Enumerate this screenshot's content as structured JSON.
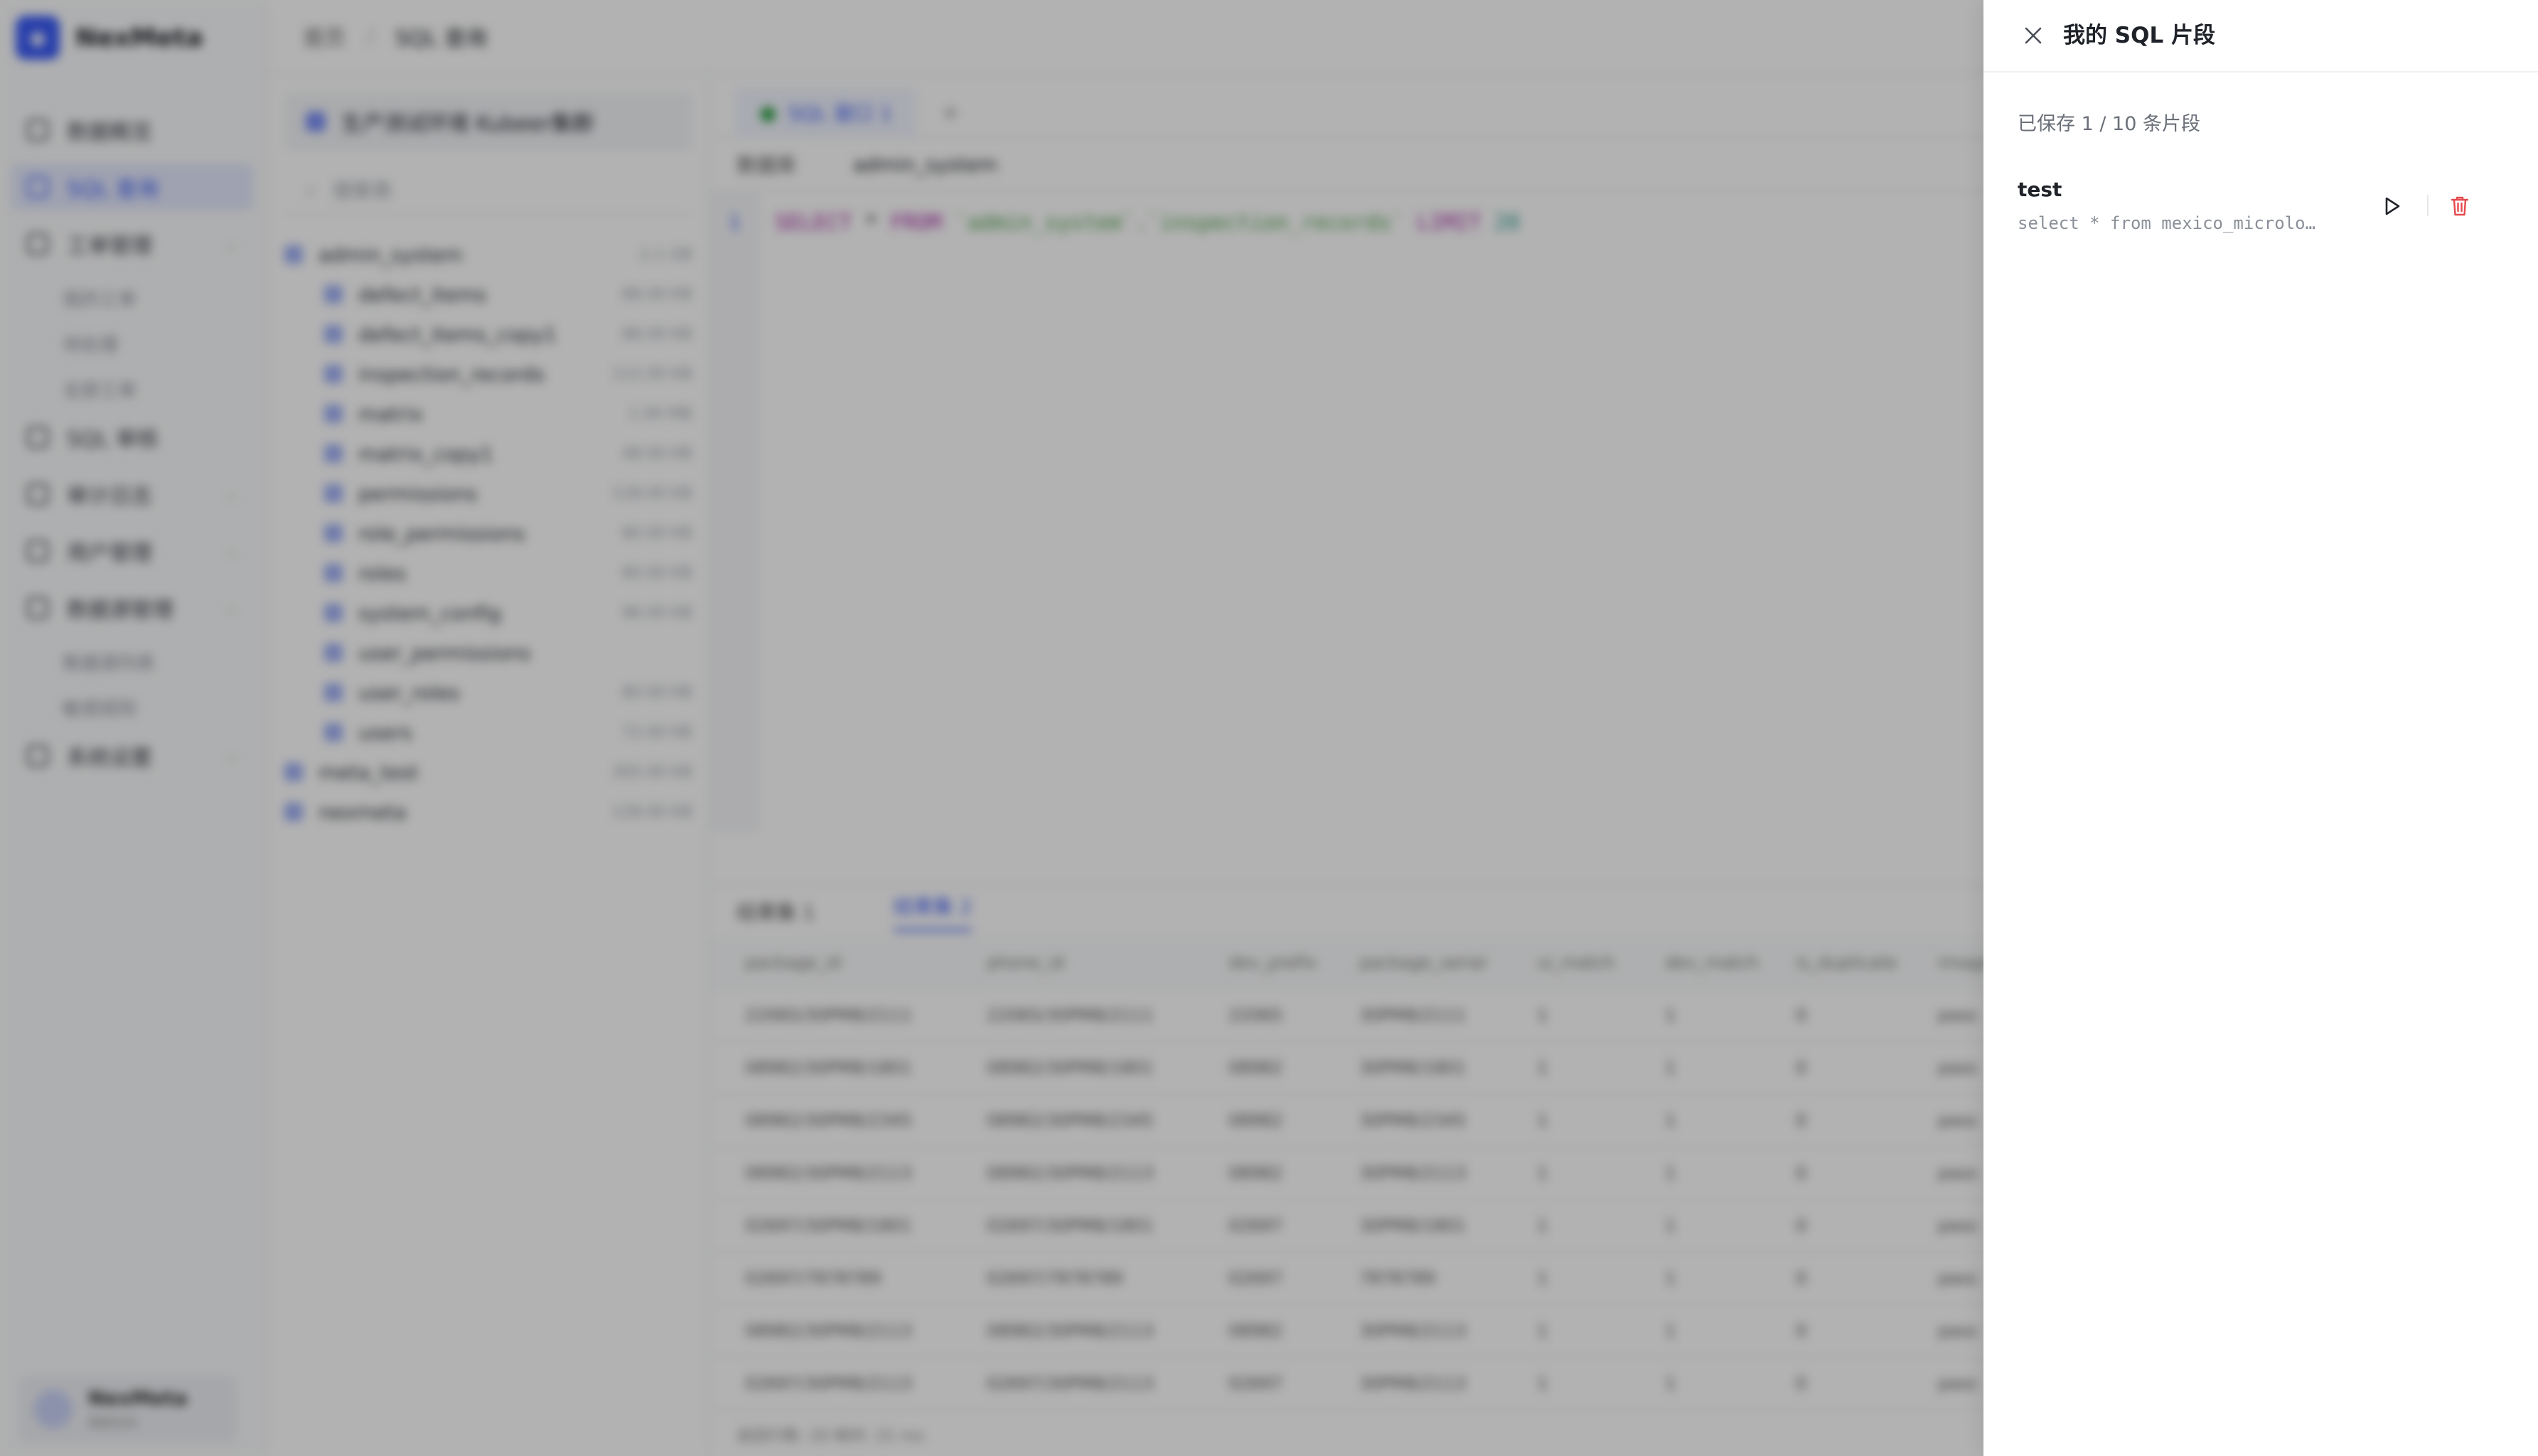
{
  "app": {
    "brand": "NexMeta",
    "nav": [
      {
        "label": "数据概览",
        "active": false,
        "caret": false
      },
      {
        "label": "SQL 查询",
        "active": true,
        "caret": false
      },
      {
        "label": "工单管理",
        "active": false,
        "caret": true
      }
    ],
    "nav_sub": [
      "我的工单",
      "待处理",
      "全部工单"
    ],
    "nav2": [
      {
        "label": "SQL 审核",
        "caret": false
      },
      {
        "label": "审计日志",
        "caret": true
      },
      {
        "label": "用户管理",
        "caret": true
      },
      {
        "label": "数据源管理",
        "caret": true
      }
    ],
    "nav_sub2": [
      "数据源列表",
      "敏感规则"
    ],
    "nav3": [
      {
        "label": "系统设置",
        "caret": true
      }
    ],
    "user": {
      "name": "NexMeta",
      "role": "Admin"
    },
    "breadcrumb": [
      "首页",
      "SQL 查询"
    ],
    "connection": "生产测试环境 Kubeer集群",
    "tree_search_placeholder": "搜索表",
    "tree": [
      {
        "label": "admin_system",
        "count": "2.1 GB",
        "indent": 0
      },
      {
        "label": "defect_items",
        "count": "88.00 KB",
        "indent": 1
      },
      {
        "label": "defect_items_copy1",
        "count": "88.00 KB",
        "indent": 1
      },
      {
        "label": "inspection_records",
        "count": "112.00 KB",
        "indent": 1
      },
      {
        "label": "matrix",
        "count": "1.00 MB",
        "indent": 1
      },
      {
        "label": "matrix_copy1",
        "count": "48.00 KB",
        "indent": 1
      },
      {
        "label": "permissions",
        "count": "128.00 KB",
        "indent": 1
      },
      {
        "label": "role_permissions",
        "count": "80.00 KB",
        "indent": 1
      },
      {
        "label": "roles",
        "count": "80.00 KB",
        "indent": 1
      },
      {
        "label": "system_config",
        "count": "96.00 KB",
        "indent": 1
      },
      {
        "label": "user_permissions",
        "count": "",
        "indent": 1
      },
      {
        "label": "user_roles",
        "count": "80.00 KB",
        "indent": 1
      },
      {
        "label": "users",
        "count": "72.00 KB",
        "indent": 1
      },
      {
        "label": "meta_test",
        "count": "305.00 KB",
        "indent": 0
      },
      {
        "label": "nexmeta",
        "count": "128.00 KB",
        "indent": 0
      }
    ],
    "editor_tab": "SQL 窗口 1",
    "db_label": "数据库",
    "db_value": "admin_system",
    "sql_line_number": "1",
    "sql": {
      "kw1": "SELECT",
      "star": " * ",
      "kw2": "FROM",
      "tbl": " `admin_system`.`inspection_records` ",
      "kw3": "LIMIT",
      "num": " 20"
    },
    "result_tabs": [
      "结果集 1",
      "结果集 2"
    ],
    "columns": [
      "package_id",
      "phone_id",
      "dev_prefix",
      "package_serial",
      "ui_match",
      "dev_match",
      "is_duplicate",
      "image"
    ],
    "rows": [
      [
        "22065/30PM8/2111",
        "22065/30PM8/2111",
        "22065",
        "30PM8/2111",
        "1",
        "1",
        "0",
        "pass"
      ],
      [
        "08982/30PM8/1801",
        "08982/30PM8/1801",
        "08982",
        "30PM8/1801",
        "1",
        "1",
        "0",
        "pass"
      ],
      [
        "08982/30PM8/2345",
        "08982/30PM8/2345",
        "08982",
        "30PM8/2345",
        "1",
        "1",
        "0",
        "pass"
      ],
      [
        "08982/30PM8/2113",
        "08982/30PM8/2113",
        "08982",
        "30PM8/2113",
        "1",
        "1",
        "0",
        "pass"
      ],
      [
        "02697/30PM8/1801",
        "02697/30PM8/1801",
        "02697",
        "30PM8/1801",
        "1",
        "1",
        "0",
        "pass"
      ],
      [
        "02697/7878789",
        "02697/7878789",
        "02697",
        "7878789",
        "1",
        "1",
        "0",
        "pass"
      ],
      [
        "08982/30PM8/2113",
        "08982/30PM8/2113",
        "08982",
        "30PM8/2113",
        "1",
        "1",
        "0",
        "pass"
      ],
      [
        "02697/30PM8/2113",
        "02697/30PM8/2113",
        "02697",
        "30PM8/2113",
        "1",
        "1",
        "0",
        "pass"
      ]
    ],
    "result_footer": "返回行数: 20    耗时: 21 ms"
  },
  "drawer": {
    "title": "我的 SQL 片段",
    "count_text": "已保存 1 / 10 条片段",
    "snippets": [
      {
        "name": "test",
        "sql": "select * from mexico_microlo…"
      }
    ],
    "icons": {
      "close": "close-icon",
      "run": "play-icon",
      "delete": "trash-icon"
    },
    "colors": {
      "delete": "#e5484d",
      "run": "#1f2329",
      "overlay": "rgba(0,0,0,0.30)"
    }
  }
}
